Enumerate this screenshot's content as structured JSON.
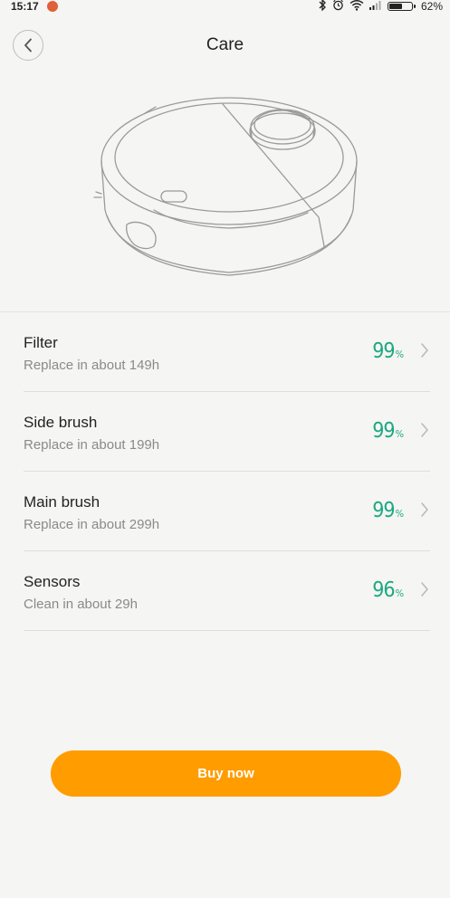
{
  "status_bar": {
    "time": "15:17",
    "battery_text": "62%",
    "battery_level": 0.62,
    "icons": [
      "bluetooth-icon",
      "alarm-icon",
      "wifi-icon",
      "signal-icon",
      "battery-icon"
    ]
  },
  "header": {
    "title": "Care",
    "back_icon": "chevron-left-icon"
  },
  "image": {
    "subject": "robot-vacuum-illustration"
  },
  "items": [
    {
      "title": "Filter",
      "subtitle": "Replace in about 149h",
      "percent": "99",
      "unit": "%"
    },
    {
      "title": "Side brush",
      "subtitle": "Replace in about 199h",
      "percent": "99",
      "unit": "%"
    },
    {
      "title": "Main brush",
      "subtitle": "Replace in about 299h",
      "percent": "99",
      "unit": "%"
    },
    {
      "title": "Sensors",
      "subtitle": "Clean in about 29h",
      "percent": "96",
      "unit": "%"
    }
  ],
  "buy_button": {
    "label": "Buy now"
  },
  "colors": {
    "accent_orange": "#ff9c00",
    "percent_green": "#1ea884",
    "background": "#f5f5f3"
  }
}
